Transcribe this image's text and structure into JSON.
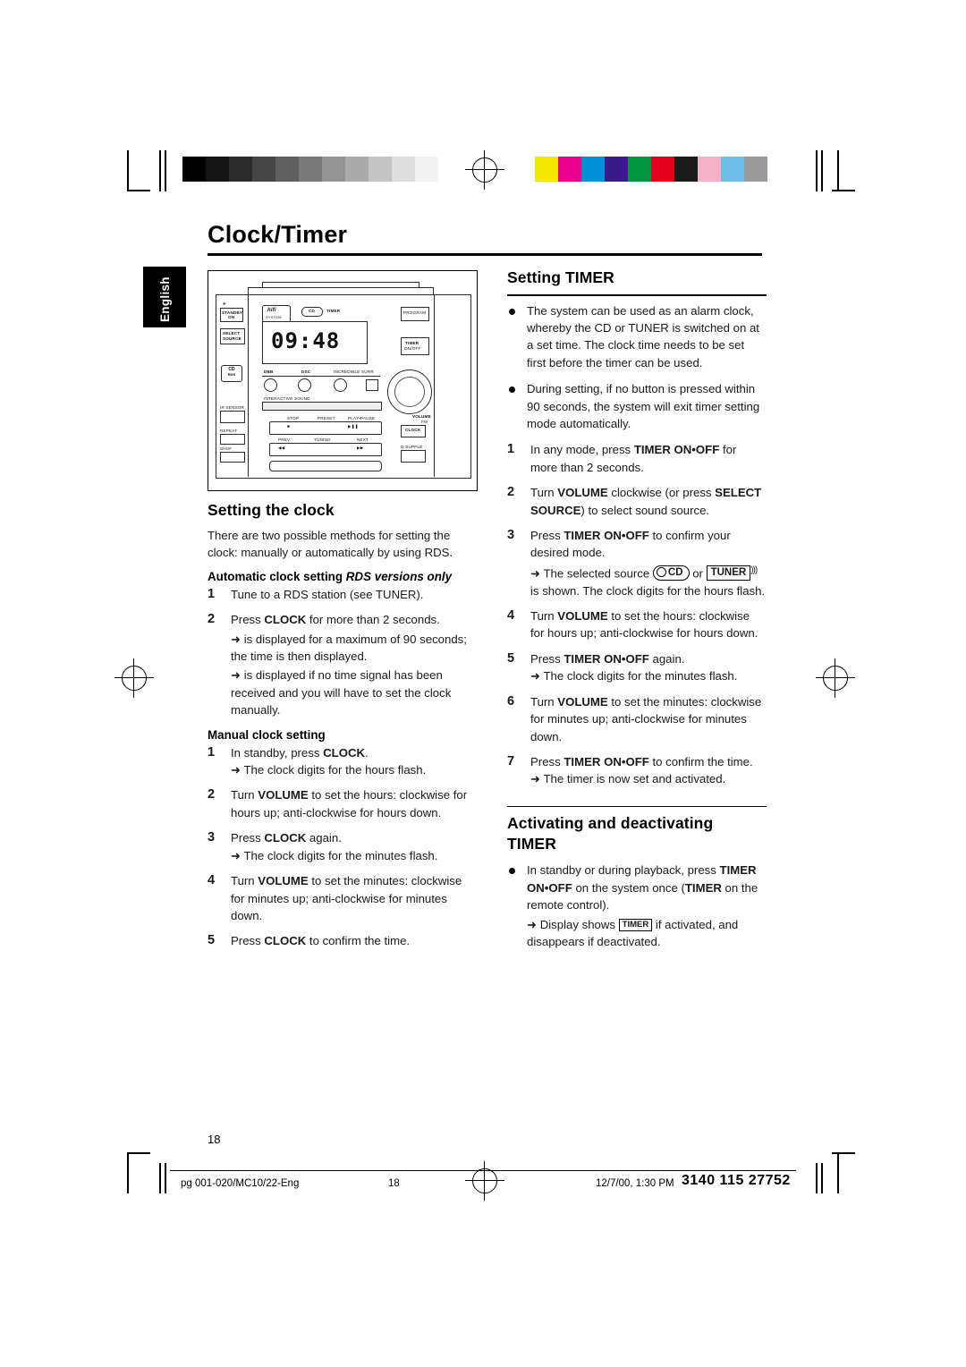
{
  "page": {
    "title": "Clock/Timer",
    "side_tab": "English",
    "number": "18"
  },
  "footer": {
    "left": "pg 001-020/MC10/22-Eng",
    "middle": "18",
    "date": "12/7/00, 1:30 PM",
    "code": "3140 115 27752"
  },
  "device": {
    "labels": {
      "standby": "STANDBY",
      "on": "ON",
      "select": "SELECT",
      "source": "SOURCE",
      "brand": "hifi",
      "brand_sub": "SYSTEM",
      "cd_logo": "CD",
      "cd_logo_sub": "RDS",
      "timer_lcd": "TIMER",
      "program": "PROGRAM",
      "timer_btn": "TIMER",
      "timer_btn_sub": "ON/OFF",
      "dbb": "DBB",
      "dsc": "DSC",
      "incredible": "INCREDIBLE SURR",
      "interactive": "INTERACTIVE SOUND",
      "volume": "VOLUME",
      "ir_sensor": "IR SENSOR",
      "repeat": "REPEAT",
      "shuffle": "SHUF",
      "stop": "STOP",
      "presets": "PRESET",
      "play_pause": "PLAY•PAUSE",
      "prev": "PREV",
      "tuning": "TUNING",
      "next": "NEXT",
      "clock": "CLOCK",
      "fm": "FM",
      "dsc_pile": "D-SUPPLE",
      "clock_digits": "09:48"
    }
  },
  "left_column": {
    "heading": "Setting the clock",
    "intro": "There are two possible methods for setting the clock: manually or automatically by using RDS.",
    "auto_heading_plain": "Automatic clock setting ",
    "auto_heading_italic": "RDS versions only",
    "auto_steps": [
      {
        "num": "1",
        "text": "Tune to a RDS station (see TUNER)."
      },
      {
        "num": "2",
        "text": "Press CLOCK for more than 2 seconds.",
        "bold_word": "CLOCK",
        "sub_lines": [
          "➜               is displayed for a maximum of 90 seconds; the time is then displayed.",
          "➜                       is displayed if no time signal has been received and you will have to set the clock manually."
        ]
      }
    ],
    "manual_heading": "Manual clock setting",
    "manual_steps": [
      {
        "num": "1",
        "text": "In standby, press CLOCK.",
        "sub": "➜ The clock digits for the hours flash."
      },
      {
        "num": "2",
        "text": "Turn VOLUME to set the hours: clockwise for hours up; anti-clockwise for hours down."
      },
      {
        "num": "3",
        "text": "Press CLOCK again.",
        "sub": "➜ The clock digits for the minutes flash."
      },
      {
        "num": "4",
        "text": "Turn VOLUME to set the minutes: clockwise for minutes up; anti-clockwise for minutes down."
      },
      {
        "num": "5",
        "text": "Press CLOCK to confirm the time."
      }
    ]
  },
  "right_column": {
    "heading_timer": "Setting TIMER",
    "bullets": [
      "The system can be used as an alarm clock, whereby the CD or TUNER is switched on at a set time. The clock time needs to be set first before the timer can be used.",
      "During setting, if no button is pressed within 90 seconds, the system will exit timer setting mode automatically."
    ],
    "steps": [
      {
        "num": "1",
        "text": "In any mode, press TIMER ON•OFF for more than 2 seconds."
      },
      {
        "num": "2",
        "text": "Turn VOLUME clockwise (or press SELECT SOURCE) to select sound source."
      },
      {
        "num": "3",
        "text": "Press TIMER ON•OFF to confirm your desired mode.",
        "sub_prefix": "➜ The selected source ",
        "sub_mid": " or ",
        "sub_suffix": "is shown. The clock digits for the hours flash.",
        "badge_cd": "CD",
        "badge_tuner": "TUNER"
      },
      {
        "num": "4",
        "text": "Turn VOLUME to set the hours: clockwise for hours up; anti-clockwise for hours down."
      },
      {
        "num": "5",
        "text": "Press TIMER ON•OFF again.",
        "sub": "➜ The clock digits for the minutes flash."
      },
      {
        "num": "6",
        "text": "Turn VOLUME to set the minutes: clockwise for minutes up; anti-clockwise for minutes down."
      },
      {
        "num": "7",
        "text": "Press TIMER ON•OFF to confirm the time.",
        "sub": "➜ The timer is now set and activated."
      }
    ],
    "heading_activating_line1": "Activating and deactivating",
    "heading_activating_line2": "TIMER",
    "activating_bullet": "In standby or during playback, press TIMER ON•OFF on the system once (TIMER on the remote control).",
    "activating_sub_prefix": "➜ Display shows ",
    "activating_badge": "TIMER",
    "activating_sub_suffix": " if activated, and disappears if deactivated."
  },
  "marks": {
    "grey_swatches": [
      "#000000",
      "#141414",
      "#2b2b2b",
      "#464646",
      "#5f5f5f",
      "#787878",
      "#939393",
      "#ababab",
      "#c4c4c4",
      "#dddddd",
      "#f2f2f2"
    ],
    "color_swatches": [
      "#f5e800",
      "#e8008c",
      "#0090d8",
      "#3b1a8c",
      "#009640",
      "#e3001b",
      "#1a1a1a",
      "#f6b2c8",
      "#6ec0ea",
      "#9a9a9a"
    ]
  }
}
